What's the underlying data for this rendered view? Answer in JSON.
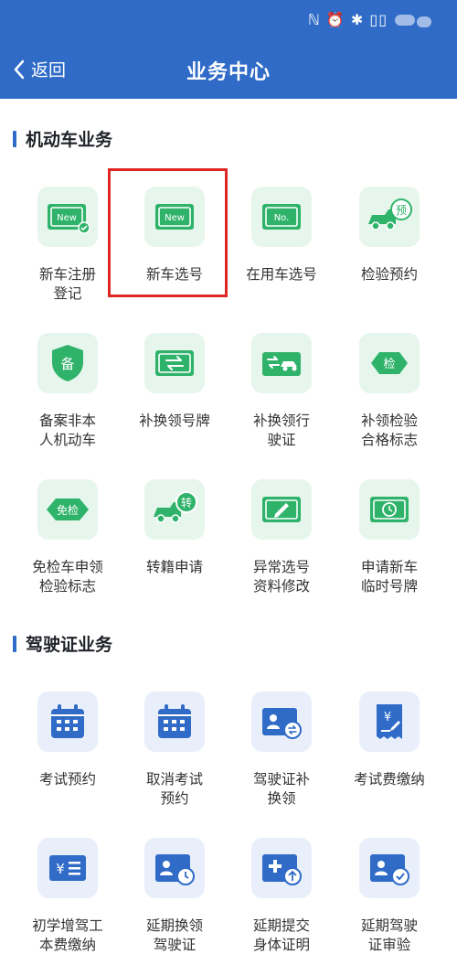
{
  "status_bar": {
    "icons": "ℕ ⏰ ✱ ▯▯"
  },
  "header": {
    "back_label": "返回",
    "title": "业务中心",
    "bg_color": "#2f6bc7"
  },
  "sections": [
    {
      "title": "机动车业务",
      "theme": "green",
      "items": [
        {
          "label": "新车注册\n登记",
          "icon": "new-plate-check-icon"
        },
        {
          "label": "新车选号",
          "icon": "new-plate-icon",
          "highlighted": true
        },
        {
          "label": "在用车选号",
          "icon": "no-plate-icon"
        },
        {
          "label": "检验预约",
          "icon": "truck-appointment-icon",
          "badge": "预"
        },
        {
          "label": "备案非本\n人机动车",
          "icon": "shield-icon",
          "badge": "备"
        },
        {
          "label": "补换领号牌",
          "icon": "swap-plate-icon"
        },
        {
          "label": "补换领行\n驶证",
          "icon": "swap-car-icon"
        },
        {
          "label": "补领检验\n合格标志",
          "icon": "inspection-diamond-icon",
          "badge": "检"
        },
        {
          "label": "免检车申领\n检验标志",
          "icon": "exempt-diamond-icon",
          "badge": "免检"
        },
        {
          "label": "转籍申请",
          "icon": "truck-transfer-icon",
          "badge": "转"
        },
        {
          "label": "异常选号\n资料修改",
          "icon": "plate-edit-icon"
        },
        {
          "label": "申请新车\n临时号牌",
          "icon": "plate-clock-icon"
        }
      ]
    },
    {
      "title": "驾驶证业务",
      "theme": "blue",
      "items": [
        {
          "label": "考试预约",
          "icon": "calendar-icon"
        },
        {
          "label": "取消考试\n预约",
          "icon": "calendar-icon"
        },
        {
          "label": "驾驶证补\n换领",
          "icon": "license-swap-icon"
        },
        {
          "label": "考试费缴纳",
          "icon": "receipt-yen-icon"
        },
        {
          "label": "初学增驾工\n本费缴纳",
          "icon": "yen-card-icon"
        },
        {
          "label": "延期换领\n驾驶证",
          "icon": "license-clock-icon"
        },
        {
          "label": "延期提交\n身体证明",
          "icon": "medical-upload-icon"
        },
        {
          "label": "延期驾驶\n证审验",
          "icon": "license-check-icon"
        }
      ]
    }
  ]
}
